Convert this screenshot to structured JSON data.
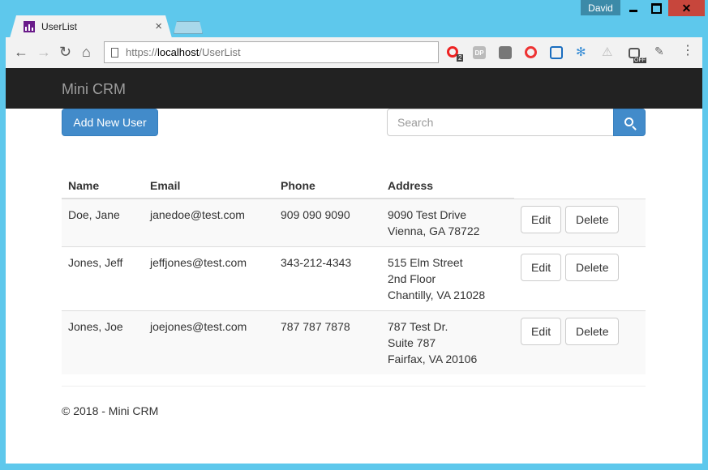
{
  "window": {
    "user": "David"
  },
  "tab": {
    "title": "UserList"
  },
  "address": {
    "proto": "https://",
    "host": "localhost",
    "path": "/UserList"
  },
  "extensions": {
    "opera_badge": "2",
    "dp_label": "DP",
    "off_label": "OFF"
  },
  "app": {
    "brand": "Mini CRM"
  },
  "toolbar": {
    "add_label": "Add New User",
    "search_placeholder": "Search"
  },
  "table": {
    "headers": {
      "name": "Name",
      "email": "Email",
      "phone": "Phone",
      "address": "Address"
    },
    "rows": [
      {
        "name": "Doe, Jane",
        "email": "janedoe@test.com",
        "phone": "909 090 9090",
        "address": [
          "9090 Test Drive",
          "Vienna, GA 78722",
          ""
        ]
      },
      {
        "name": "Jones, Jeff",
        "email": "jeffjones@test.com",
        "phone": "343-212-4343",
        "address": [
          "515 Elm Street",
          "2nd Floor",
          "Chantilly, VA 21028"
        ]
      },
      {
        "name": "Jones, Joe",
        "email": "joejones@test.com",
        "phone": "787 787 7878",
        "address": [
          "787 Test Dr.",
          "Suite 787",
          "Fairfax, VA 20106"
        ]
      }
    ],
    "edit_label": "Edit",
    "delete_label": "Delete"
  },
  "footer": {
    "text": "© 2018 - Mini CRM"
  },
  "colors": {
    "primary": "#428bca",
    "navbar": "#222222",
    "chrome": "#5ec8ec",
    "close": "#c7463c"
  }
}
